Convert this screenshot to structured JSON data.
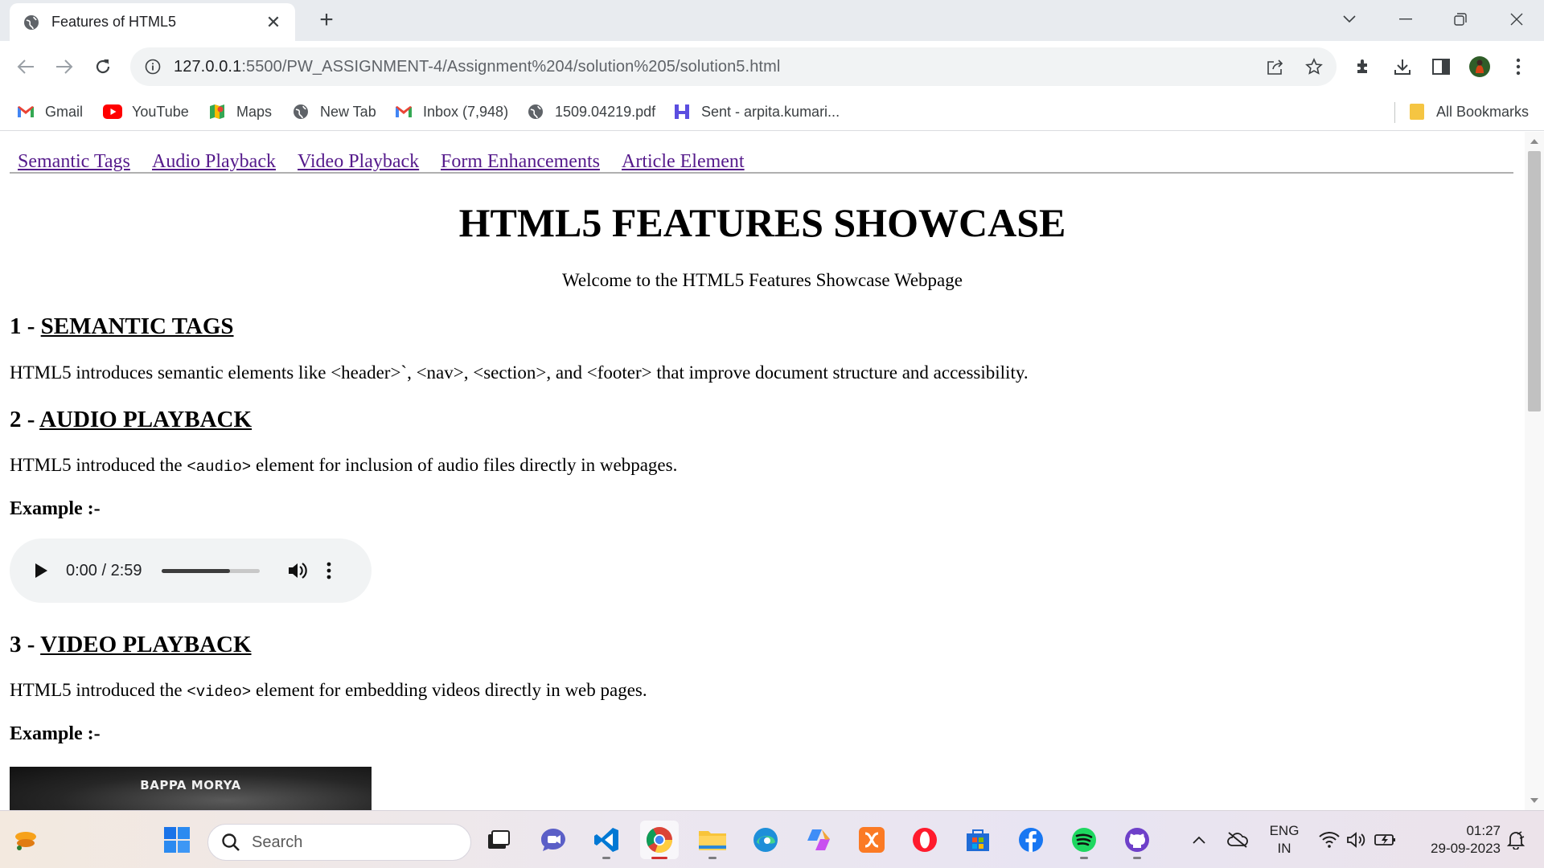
{
  "browser": {
    "tab_title": "Features of HTML5",
    "url_prefix": "127.0.0.1",
    "url_rest": ":5500/PW_ASSIGNMENT-4/Assignment%204/solution%205/solution5.html",
    "bookmarks": [
      {
        "label": "Gmail",
        "icon": "gmail-icon"
      },
      {
        "label": "YouTube",
        "icon": "youtube-icon"
      },
      {
        "label": "Maps",
        "icon": "maps-icon"
      },
      {
        "label": "New Tab",
        "icon": "globe-icon"
      },
      {
        "label": "Inbox (7,948)",
        "icon": "gmail-icon"
      },
      {
        "label": "1509.04219.pdf",
        "icon": "globe-icon"
      },
      {
        "label": "Sent - arpita.kumari...",
        "icon": "outlook-icon"
      }
    ],
    "all_bookmarks": "All Bookmarks"
  },
  "page": {
    "nav": [
      "Semantic Tags",
      "Audio Playback",
      "Video Playback",
      "Form Enhancements",
      "Article Element"
    ],
    "title": "HTML5 FEATURES SHOWCASE",
    "welcome": "Welcome to the HTML5 Features Showcase Webpage",
    "sections": [
      {
        "num": "1 - ",
        "heading": "SEMANTIC TAGS",
        "text": "HTML5 introduces semantic elements like <header>`, <nav>, <section>, and <footer> that improve document structure and accessibility."
      },
      {
        "num": "2 - ",
        "heading": "AUDIO PLAYBACK",
        "text_before": "HTML5 introduced the ",
        "code": "<audio>",
        "text_after": " element for inclusion of audio files directly in webpages.",
        "example": "Example :-"
      },
      {
        "num": "3 - ",
        "heading": "VIDEO PLAYBACK",
        "text_before": "HTML5 introduced the ",
        "code": "<video>",
        "text_after": " element for embedding videos directly in web pages.",
        "example": "Example :-"
      }
    ],
    "audio": {
      "time": "0:00 / 2:59",
      "volume_level": 0.7
    },
    "video": {
      "overlay_title": "BAPPA MORYA"
    }
  },
  "taskbar": {
    "search_placeholder": "Search",
    "lang_line1": "ENG",
    "lang_line2": "IN",
    "time": "01:27",
    "date": "29-09-2023"
  },
  "colors": {
    "link_visited": "#551a8b",
    "tab_strip": "#e8ebef",
    "omnibox": "#f1f3f4",
    "audio_bg": "#f1f3f4"
  }
}
